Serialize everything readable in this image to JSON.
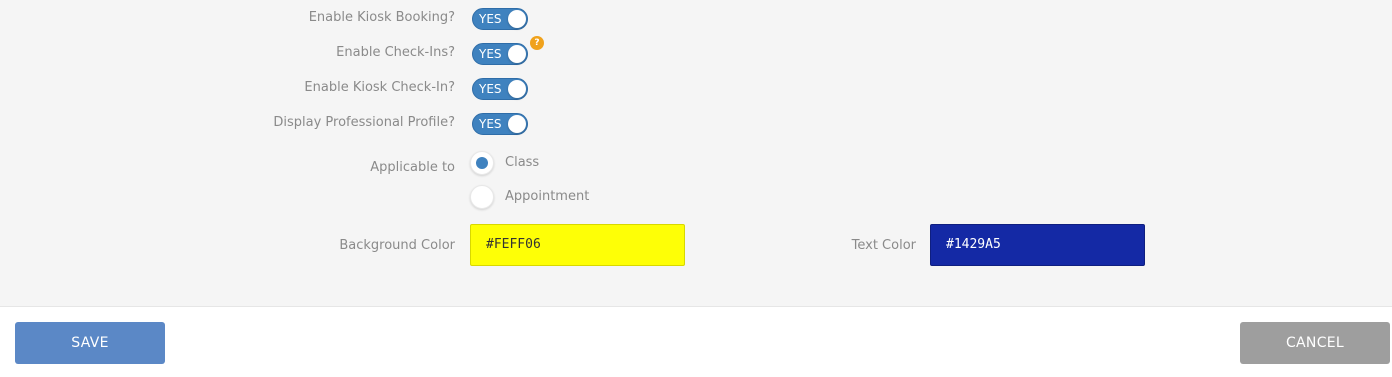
{
  "toggles": [
    {
      "label": "Enable Kiosk Booking?",
      "value": "YES"
    },
    {
      "label": "Enable Check-Ins?",
      "value": "YES",
      "help": "?"
    },
    {
      "label": "Enable Kiosk Check-In?",
      "value": "YES"
    },
    {
      "label": "Display Professional Profile?",
      "value": "YES"
    }
  ],
  "applicable_to": {
    "label": "Applicable to",
    "options": [
      {
        "label": "Class",
        "selected": true
      },
      {
        "label": "Appointment",
        "selected": false
      }
    ]
  },
  "background_color": {
    "label": "Background Color",
    "value": "#FEFF06"
  },
  "text_color": {
    "label": "Text Color",
    "value": "#1429A5"
  },
  "buttons": {
    "save": "SAVE",
    "cancel": "CANCEL"
  },
  "colors": {
    "toggle_on": "#3F82BF",
    "save_button": "#5B88C6",
    "cancel_button": "#9E9E9E",
    "help_badge": "#F0A21C"
  }
}
